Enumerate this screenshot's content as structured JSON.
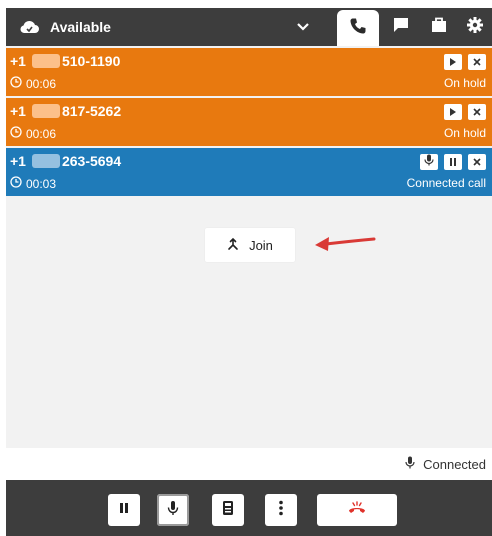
{
  "topbar": {
    "status_label": "Available",
    "icons": [
      "cloud-icon",
      "chevron-down-icon",
      "phone-icon",
      "chat-icon",
      "briefcase-icon",
      "gear-icon"
    ]
  },
  "calls": [
    {
      "prefix": "+1",
      "number": "510-1190",
      "time": "00:06",
      "state": "On hold",
      "kind": "hold",
      "actions": [
        "resume-icon",
        "close-icon"
      ]
    },
    {
      "prefix": "+1",
      "number": "817-5262",
      "time": "00:06",
      "state": "On hold",
      "kind": "hold",
      "actions": [
        "resume-icon",
        "close-icon"
      ]
    },
    {
      "prefix": "+1",
      "number": "263-5694",
      "time": "00:03",
      "state": "Connected call",
      "kind": "connected",
      "actions": [
        "mic-icon",
        "pause-icon",
        "close-icon"
      ]
    }
  ],
  "main": {
    "join_label": "Join"
  },
  "connection": {
    "status_text": "Connected"
  },
  "controls": {
    "buttons": [
      "pause-icon",
      "mic-icon",
      "keypad-icon",
      "more-icon",
      "end-call-icon"
    ]
  },
  "colors": {
    "hold": "#e8790f",
    "connected": "#1f7bb9",
    "bar": "#3d3d3d",
    "end_call": "#e0322b",
    "arrow": "#d93a36"
  }
}
